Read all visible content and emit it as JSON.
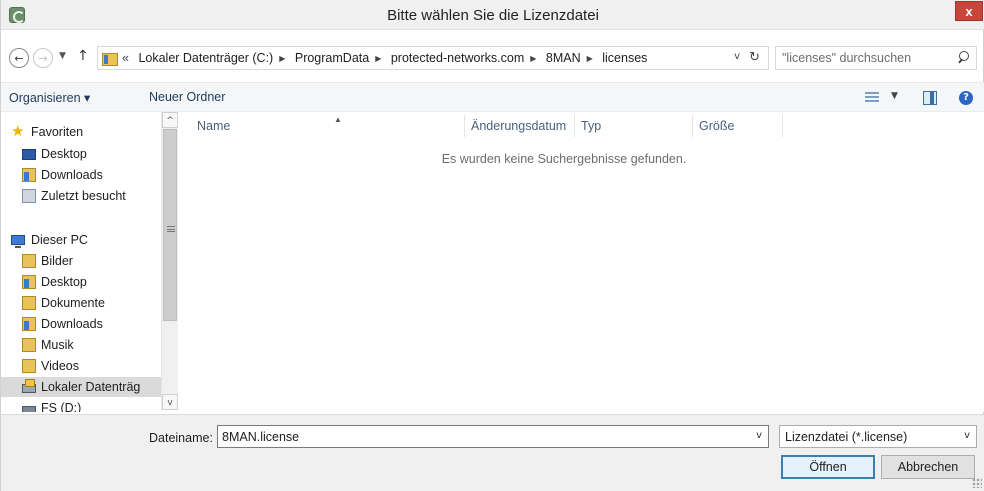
{
  "window": {
    "title": "Bitte wählen Sie die Lizenzdatei",
    "close_label": "x"
  },
  "nav": {
    "back_glyph": "←",
    "forward_glyph": "→",
    "recent_glyph": "▼",
    "up_glyph": "↑"
  },
  "address": {
    "overflow": "«",
    "crumbs": [
      "Lokaler Datenträger (C:)",
      "ProgramData",
      "protected-networks.com",
      "8MAN",
      "licenses"
    ],
    "dropdown_glyph": "v",
    "refresh_glyph": "↻"
  },
  "search": {
    "placeholder": "\"licenses\" durchsuchen"
  },
  "toolbar": {
    "organize": "Organisieren ▾",
    "new_folder": "Neuer Ordner",
    "view_dropdown": "▼",
    "help": "?"
  },
  "sidebar": {
    "favorites": "Favoriten",
    "fav_items": [
      "Desktop",
      "Downloads",
      "Zuletzt besucht"
    ],
    "this_pc": "Dieser PC",
    "pc_items": [
      "Bilder",
      "Desktop",
      "Dokumente",
      "Downloads",
      "Musik",
      "Videos",
      "Lokaler Datenträg"
    ],
    "drive_fs": "FS (D:)",
    "scroll_up": "^",
    "scroll_down": "v"
  },
  "filelist": {
    "columns": [
      "Name",
      "Änderungsdatum",
      "Typ",
      "Größe"
    ],
    "sort_glyph": "▲",
    "empty_message": "Es wurden keine Suchergebnisse gefunden."
  },
  "bottom": {
    "filename_label": "Dateiname:",
    "filename_value": "8MAN.license",
    "filename_dropdown": "v",
    "filetype": "Lizenzdatei (*.license)",
    "filetype_dropdown": "v",
    "open_label": "Öffnen",
    "cancel_label": "Abbrechen"
  }
}
